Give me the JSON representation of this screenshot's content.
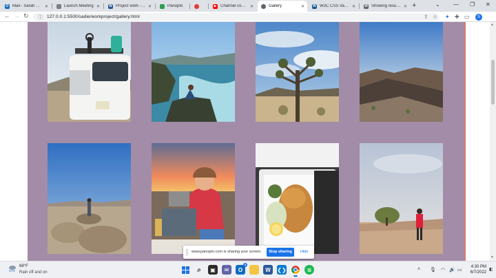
{
  "browser": {
    "tabs": [
      {
        "title": "Mail - Sarah Hay",
        "icon": "outlook-icon",
        "color": "#0f6cbd"
      },
      {
        "title": "Launch Meeting",
        "icon": "document-icon",
        "color": "#7e7e7e"
      },
      {
        "title": "Project work - Ins",
        "icon": "word-icon",
        "color": "#2b579a"
      },
      {
        "title": "Panopto",
        "icon": "panopto-icon",
        "color": "#2e9e4f"
      },
      {
        "title": "",
        "icon": "record-icon",
        "color": "#e53935"
      },
      {
        "title": "Channel content",
        "icon": "youtube-icon",
        "color": "#ff0000"
      },
      {
        "title": "Gallery",
        "icon": "globe-icon",
        "color": "#5f6368"
      },
      {
        "title": "W3C CSS Validat",
        "icon": "w3c-icon",
        "color": "#1a5a96"
      },
      {
        "title": "Showing results f",
        "icon": "wiki-icon",
        "color": "#666666"
      }
    ],
    "active_tab_index": 6,
    "url": "127.0.0.1:5500/sadie/workproject/gallery.html",
    "profile_initial": "S"
  },
  "gallery": {
    "photos": [
      {
        "name": "photo-van-camping",
        "subject": "White van with kayaks and bikes on roof"
      },
      {
        "name": "photo-coastal-cliffs",
        "subject": "Person on cliff edge above ocean"
      },
      {
        "name": "photo-joshua-tree",
        "subject": "Joshua tree under cloudy sky"
      },
      {
        "name": "photo-desert-sunset",
        "subject": "Desert mountains at sunset"
      },
      {
        "name": "photo-hiker-boulders",
        "subject": "Hiker standing on desert boulders"
      },
      {
        "name": "photo-camp-stove",
        "subject": "Smiling camper cooking at sunset"
      },
      {
        "name": "photo-takeout-food",
        "subject": "Takeout box with fried fish and lemon"
      },
      {
        "name": "photo-desert-hiker",
        "subject": "Hiker in red jacket in desert"
      }
    ]
  },
  "share_banner": {
    "message": "www.panopto.com is sharing your screen.",
    "stop_label": "Stop sharing",
    "hide_label": "Hide"
  },
  "taskbar": {
    "temperature": "68°F",
    "weather": "Rain off and on",
    "time": "4:30 PM",
    "date": "6/7/2022",
    "chat_badge": "3"
  }
}
